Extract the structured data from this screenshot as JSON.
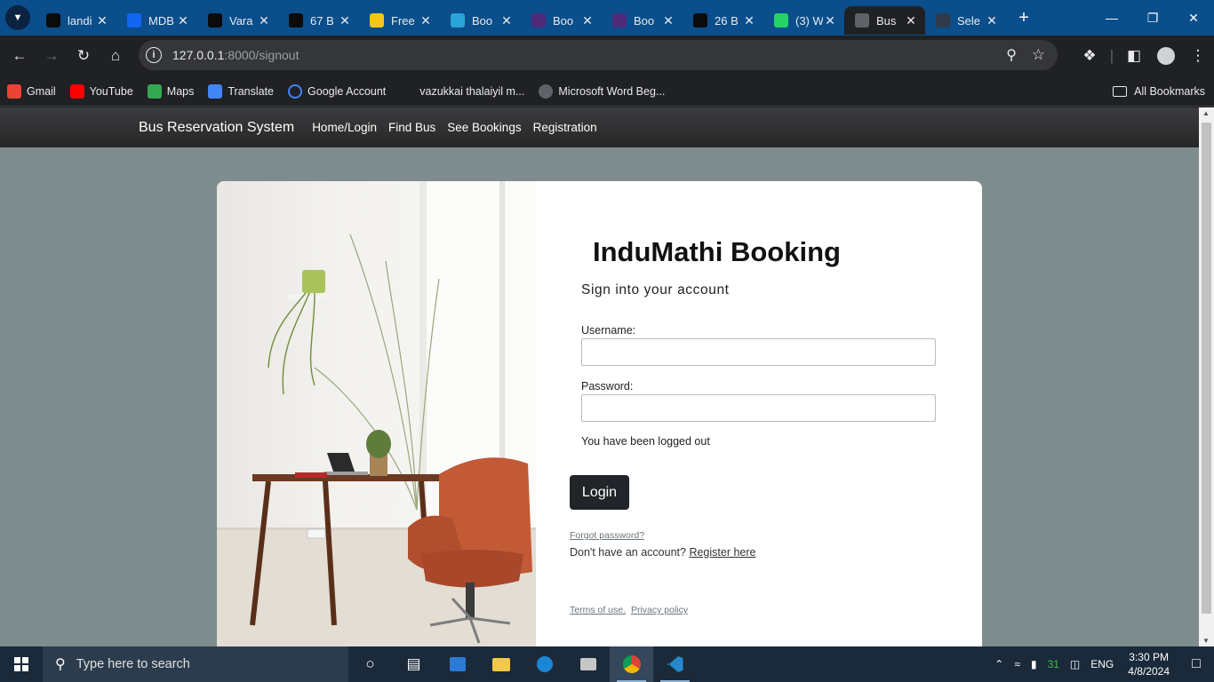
{
  "browser": {
    "tabs": [
      {
        "title": "landi",
        "favicon": "codepen-icon",
        "color": "#0b0b0b"
      },
      {
        "title": "MDB",
        "favicon": "mdb-icon",
        "color": "#1266f1"
      },
      {
        "title": "Vara",
        "favicon": "github-icon",
        "color": "#0b0b0b"
      },
      {
        "title": "67 B",
        "favicon": "f-icon",
        "color": "#0b0b0b"
      },
      {
        "title": "Free",
        "favicon": "c-icon",
        "color": "#f5c518"
      },
      {
        "title": "Boo",
        "favicon": "bd-icon",
        "color": "#2aa5d6"
      },
      {
        "title": "Boo",
        "favicon": "bootstrap-icon",
        "color": "#4d2a7a"
      },
      {
        "title": "Boo",
        "favicon": "bootstrap-icon",
        "color": "#4d2a7a"
      },
      {
        "title": "26 B",
        "favicon": "f-icon",
        "color": "#0b0b0b"
      },
      {
        "title": "(3) W",
        "favicon": "whatsapp-icon",
        "color": "#25d366"
      },
      {
        "title": "Bus",
        "favicon": "globe-icon",
        "color": "#5f6368",
        "active": true
      },
      {
        "title": "Sele",
        "favicon": "selenium-icon",
        "color": "#2f3b4a"
      }
    ],
    "url_host": "127.0.0.1",
    "url_path": ":8000/signout",
    "bookmarks": [
      {
        "label": "Gmail",
        "icon": "gmail-icon",
        "color": "#ea4335"
      },
      {
        "label": "YouTube",
        "icon": "youtube-icon",
        "color": "#ff0000"
      },
      {
        "label": "Maps",
        "icon": "maps-icon",
        "color": "#34a853"
      },
      {
        "label": "Translate",
        "icon": "translate-icon",
        "color": "#4285f4"
      },
      {
        "label": "Google Account",
        "icon": "google-icon",
        "color": "#ffffff"
      },
      {
        "label": "vazukkai thalaiyil m...",
        "icon": "",
        "color": ""
      },
      {
        "label": "Microsoft Word Beg...",
        "icon": "globe-icon",
        "color": "#5f6368"
      }
    ],
    "all_bookmarks": "All Bookmarks"
  },
  "navbar": {
    "brand": "Bus Reservation System",
    "links": [
      "Home/Login",
      "Find Bus",
      "See Bookings",
      "Registration"
    ]
  },
  "login": {
    "title": "InduMathi Booking",
    "subtitle": "Sign into your account",
    "username_label": "Username:",
    "username_value": "",
    "password_label": "Password:",
    "password_value": "",
    "message": "You have been logged out",
    "login_button": "Login",
    "forgot": "Forgot password?",
    "no_account": "Don't have an account?",
    "register": "Register here",
    "terms": "Terms of use.",
    "privacy": "Privacy policy"
  },
  "taskbar": {
    "search_placeholder": "Type here to search",
    "time": "3:30 PM",
    "date": "4/8/2024",
    "language": "ENG",
    "battery_badge": "31"
  }
}
